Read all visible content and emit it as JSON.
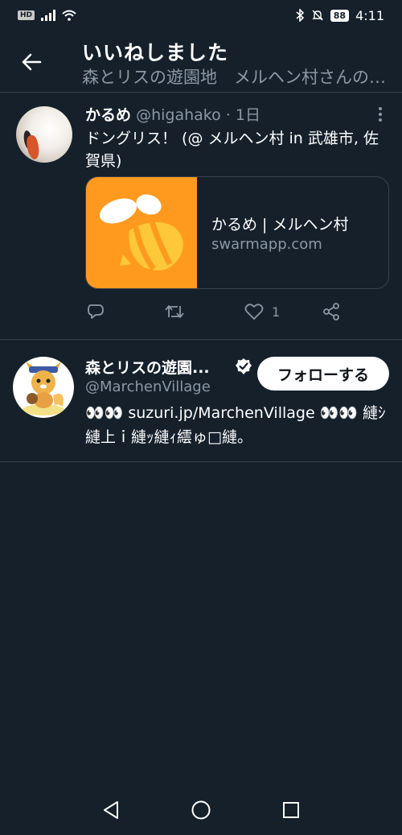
{
  "status_bar": {
    "hd": "HD",
    "battery": "88",
    "time": "4:11"
  },
  "header": {
    "title": "いいねしました",
    "subtitle": "森とリスの遊園地　メルヘン村さんのツイート"
  },
  "tweet": {
    "author_name": "かるめ",
    "author_handle": "@higahako",
    "time": "· 1日",
    "text": "ドングリス！ (@ メルヘン村 in 武雄市, 佐賀県)",
    "card": {
      "title": "かるめ | メルヘン村",
      "domain": "swarmapp.com"
    },
    "actions": {
      "reply_count": "",
      "retweet_count": "",
      "like_count": "1"
    }
  },
  "user": {
    "name": "森とリスの遊園...",
    "handle": "@MarchenVillage",
    "follow_label": "フォローする",
    "bio": "👀👀 suzuri.jp/MarchenVillage 👀👀 縺ｼ縺上ｉ縺ｯ縺ｨ繧ゅ□縺。"
  },
  "colors": {
    "background": "#15202b",
    "divider": "#38444d",
    "secondary_text": "#8b98a5",
    "swarm_orange": "#ff9a1f"
  }
}
